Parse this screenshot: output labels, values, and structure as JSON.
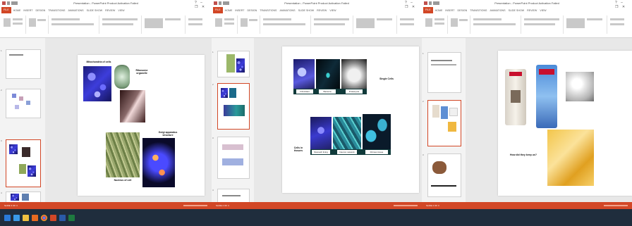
{
  "app": {
    "window_title": "Presentation - PowerPoint Product Activation Failed",
    "quick_access": "save-undo-redo",
    "window_controls": "? – ❐ ✕",
    "tabs": [
      "FILE",
      "HOME",
      "INSERT",
      "DESIGN",
      "TRANSITIONS",
      "ANIMATIONS",
      "SLIDE SHOW",
      "REVIEW",
      "VIEW"
    ],
    "accent_color": "#d24726"
  },
  "windows": [
    {
      "id": "w1",
      "thumbnails": [
        {
          "num": "1",
          "selected": false
        },
        {
          "num": "2",
          "selected": false
        },
        {
          "num": "3",
          "selected": true
        },
        {
          "num": "4",
          "selected": false
        }
      ],
      "slide": {
        "labels": [
          "Mitochondria of cells",
          "Ribosome organelle",
          "Golgi apparatus structure",
          "Nucleus of cell"
        ]
      },
      "status": "SLIDE 3 OF 4"
    },
    {
      "id": "w2",
      "thumbnails": [
        {
          "num": "1",
          "selected": false
        },
        {
          "num": "2",
          "selected": true
        },
        {
          "num": "3",
          "selected": false
        },
        {
          "num": "4",
          "selected": false
        }
      ],
      "slide": {
        "top_captions": [
          "Fibroblast",
          "Bacteria",
          "Prokaryote"
        ],
        "top_label": "Single Cells",
        "bottom_captions": [
          "Stomach lining",
          "Neuron network",
          "Fibrous tissue"
        ],
        "bottom_label": "Cells in tissues"
      },
      "status": "SLIDE 2 OF 4"
    },
    {
      "id": "w3",
      "thumbnails": [
        {
          "num": "1",
          "selected": false
        },
        {
          "num": "2",
          "selected": true
        },
        {
          "num": "3",
          "selected": false
        }
      ],
      "slide": {
        "question": "How did they keep us?"
      },
      "status": "SLIDE 2 OF 3"
    }
  ]
}
